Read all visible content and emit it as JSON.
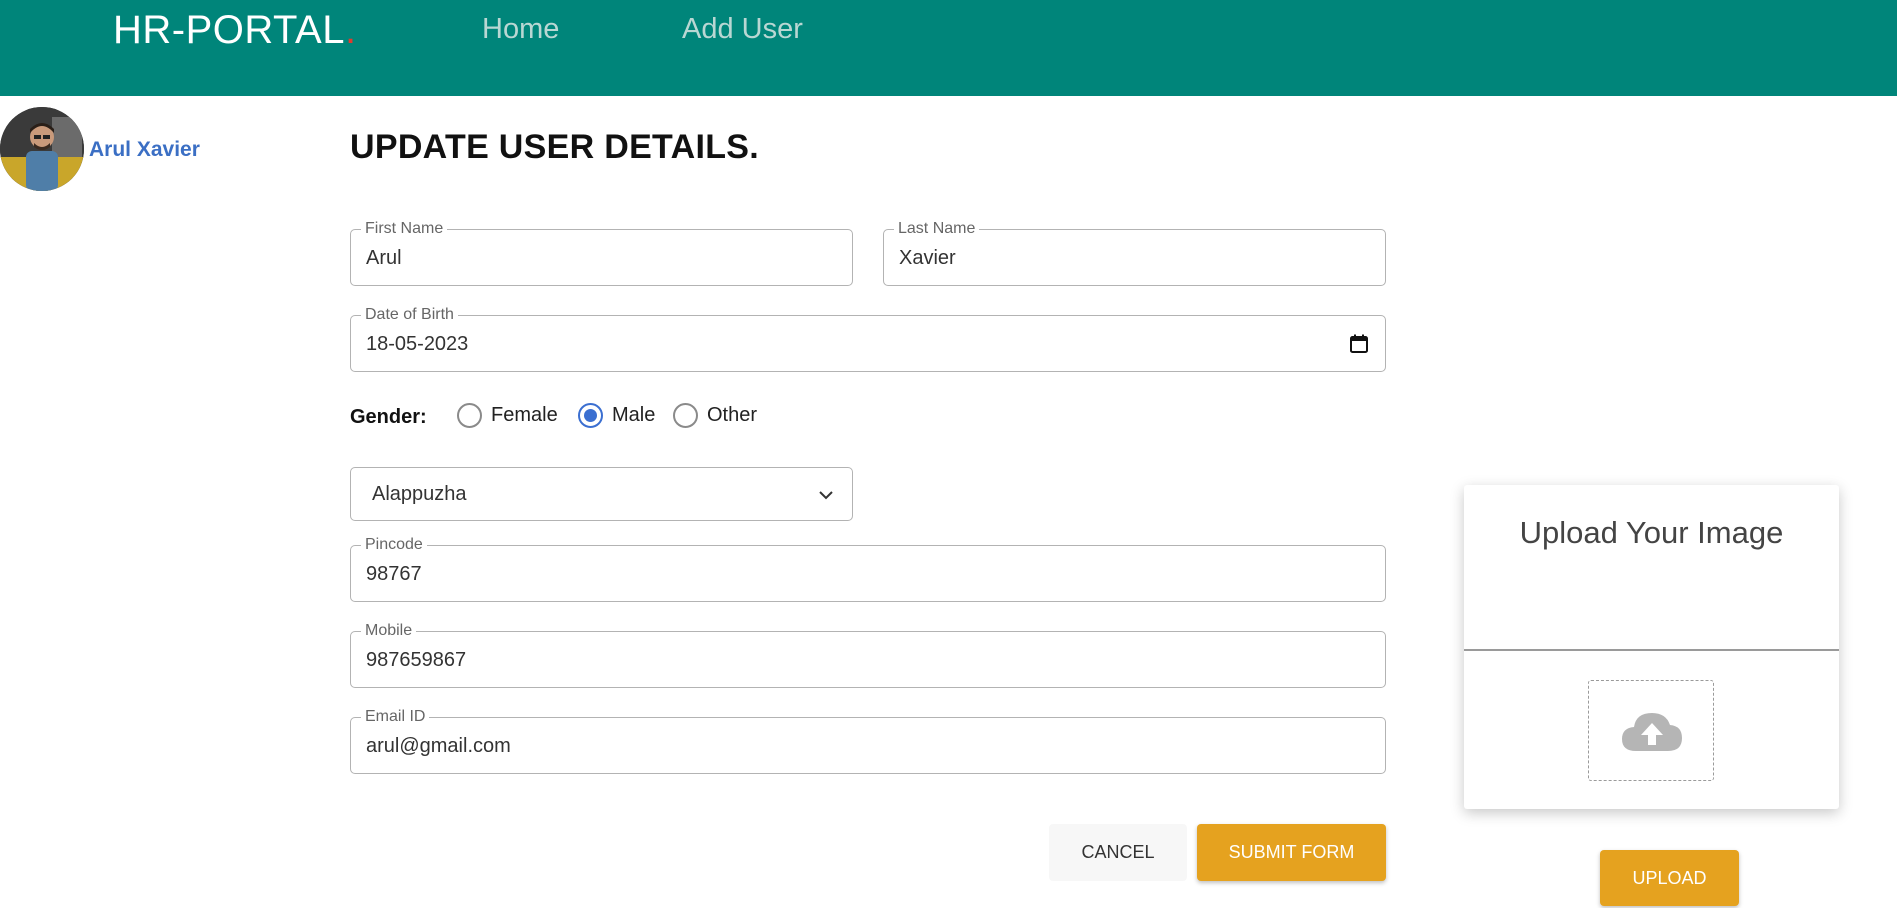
{
  "header": {
    "brand": "HR-PORTAL",
    "brand_dot": ".",
    "nav": [
      {
        "label": "Home"
      },
      {
        "label": "Add User"
      }
    ]
  },
  "profile": {
    "name": "Arul Xavier"
  },
  "form": {
    "title": "UPDATE USER DETAILS.",
    "first_name": {
      "label": "First Name",
      "value": "Arul"
    },
    "last_name": {
      "label": "Last Name",
      "value": "Xavier"
    },
    "dob": {
      "label": "Date of Birth",
      "value": "18-05-2023"
    },
    "gender": {
      "label": "Gender:",
      "options": [
        {
          "label": "Female",
          "checked": false
        },
        {
          "label": "Male",
          "checked": true
        },
        {
          "label": "Other",
          "checked": false
        }
      ]
    },
    "district": {
      "value": "Alappuzha"
    },
    "pincode": {
      "label": "Pincode",
      "value": "98767"
    },
    "mobile": {
      "label": "Mobile",
      "value": "987659867"
    },
    "email": {
      "label": "Email ID",
      "value": "arul@gmail.com"
    },
    "cancel_label": "CANCEL",
    "submit_label": "SUBMIT FORM"
  },
  "upload": {
    "title": "Upload Your Image",
    "icon": "cloud-upload-icon",
    "button_label": "UPLOAD"
  },
  "colors": {
    "header_bg": "#00857a",
    "accent": "#e5a21f",
    "link_blue": "#3b6fc4",
    "radio_selected": "#3b6fd1"
  }
}
